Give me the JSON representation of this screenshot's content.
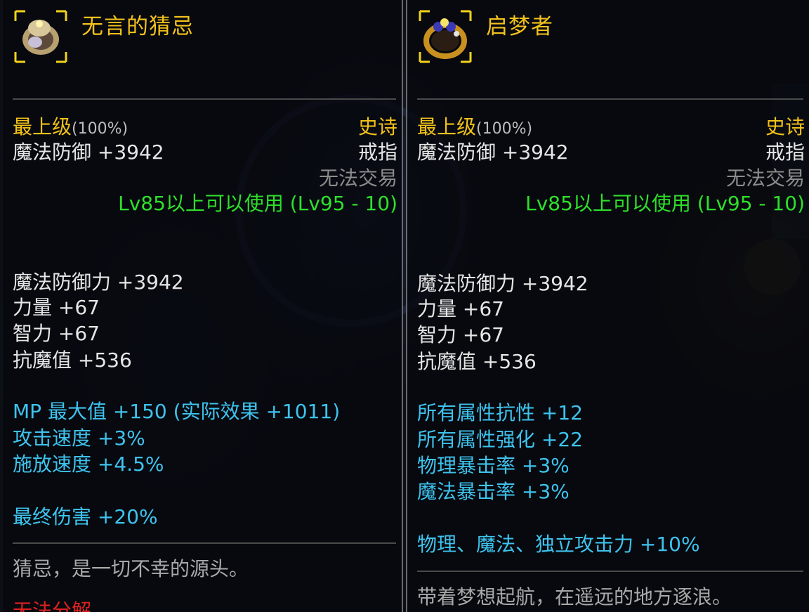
{
  "left_item": {
    "title": "无言的猜忌",
    "grade_label": "最上级",
    "grade_percent": "(100%)",
    "rarity": "史诗",
    "base_stat": "魔法防御 +3942",
    "item_type": "戒指",
    "trade": "无法交易",
    "level_req": "Lv85以上可以使用 (Lv95 - 10)",
    "stats": [
      "魔法防御力 +3942",
      "力量 +67",
      "智力 +67",
      "抗魔值 +536"
    ],
    "bonuses": [
      "MP 最大值 +150 (实际效果 +1011)",
      "攻击速度 +3%",
      "施放速度 +4.5%"
    ],
    "special": "最终伤害 +20%",
    "description": "猜忌，是一切不幸的源头。",
    "cut_off_red": "无法分解"
  },
  "right_item": {
    "title": "启梦者",
    "grade_label": "最上级",
    "grade_percent": "(100%)",
    "rarity": "史诗",
    "base_stat": "魔法防御 +3942",
    "item_type": "戒指",
    "trade": "无法交易",
    "level_req": "Lv85以上可以使用 (Lv95 - 10)",
    "stats": [
      "魔法防御力 +3942",
      "力量 +67",
      "智力 +67",
      "抗魔值 +536"
    ],
    "bonuses": [
      "所有属性抗性 +12",
      "所有属性强化 +22",
      "物理暴击率 +3%",
      "魔法暴击率 +3%"
    ],
    "special": "物理、魔法、独立攻击力 +10%",
    "description": "带着梦想起航，在遥远的地方逐浪。"
  },
  "colors": {
    "title": "#f4c21c",
    "rarity": "#f2c11a",
    "level_req": "#2ee02a",
    "bonus": "#3ec3ee",
    "stat": "#e6e6e6"
  },
  "icons": {
    "left": "ring-icon",
    "right": "ring-icon"
  }
}
